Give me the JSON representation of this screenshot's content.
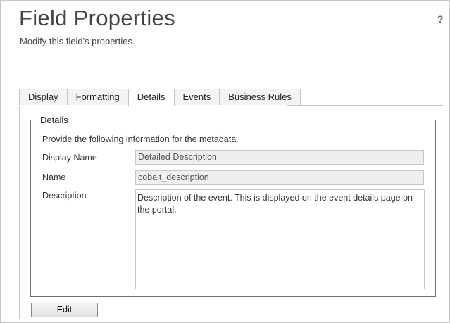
{
  "header": {
    "title": "Field Properties",
    "subtitle": "Modify this field's properties.",
    "help_label": "?"
  },
  "tabs": [
    {
      "label": "Display",
      "active": false
    },
    {
      "label": "Formatting",
      "active": false
    },
    {
      "label": "Details",
      "active": true
    },
    {
      "label": "Events",
      "active": false
    },
    {
      "label": "Business Rules",
      "active": false
    }
  ],
  "details": {
    "legend": "Details",
    "info": "Provide the following information for the metadata.",
    "display_name_label": "Display Name",
    "display_name_value": "Detailed Description",
    "name_label": "Name",
    "name_value": "cobalt_description",
    "description_label": "Description",
    "description_value": "Description of the event. This is displayed on the event details page on the portal."
  },
  "actions": {
    "edit_label": "Edit"
  }
}
